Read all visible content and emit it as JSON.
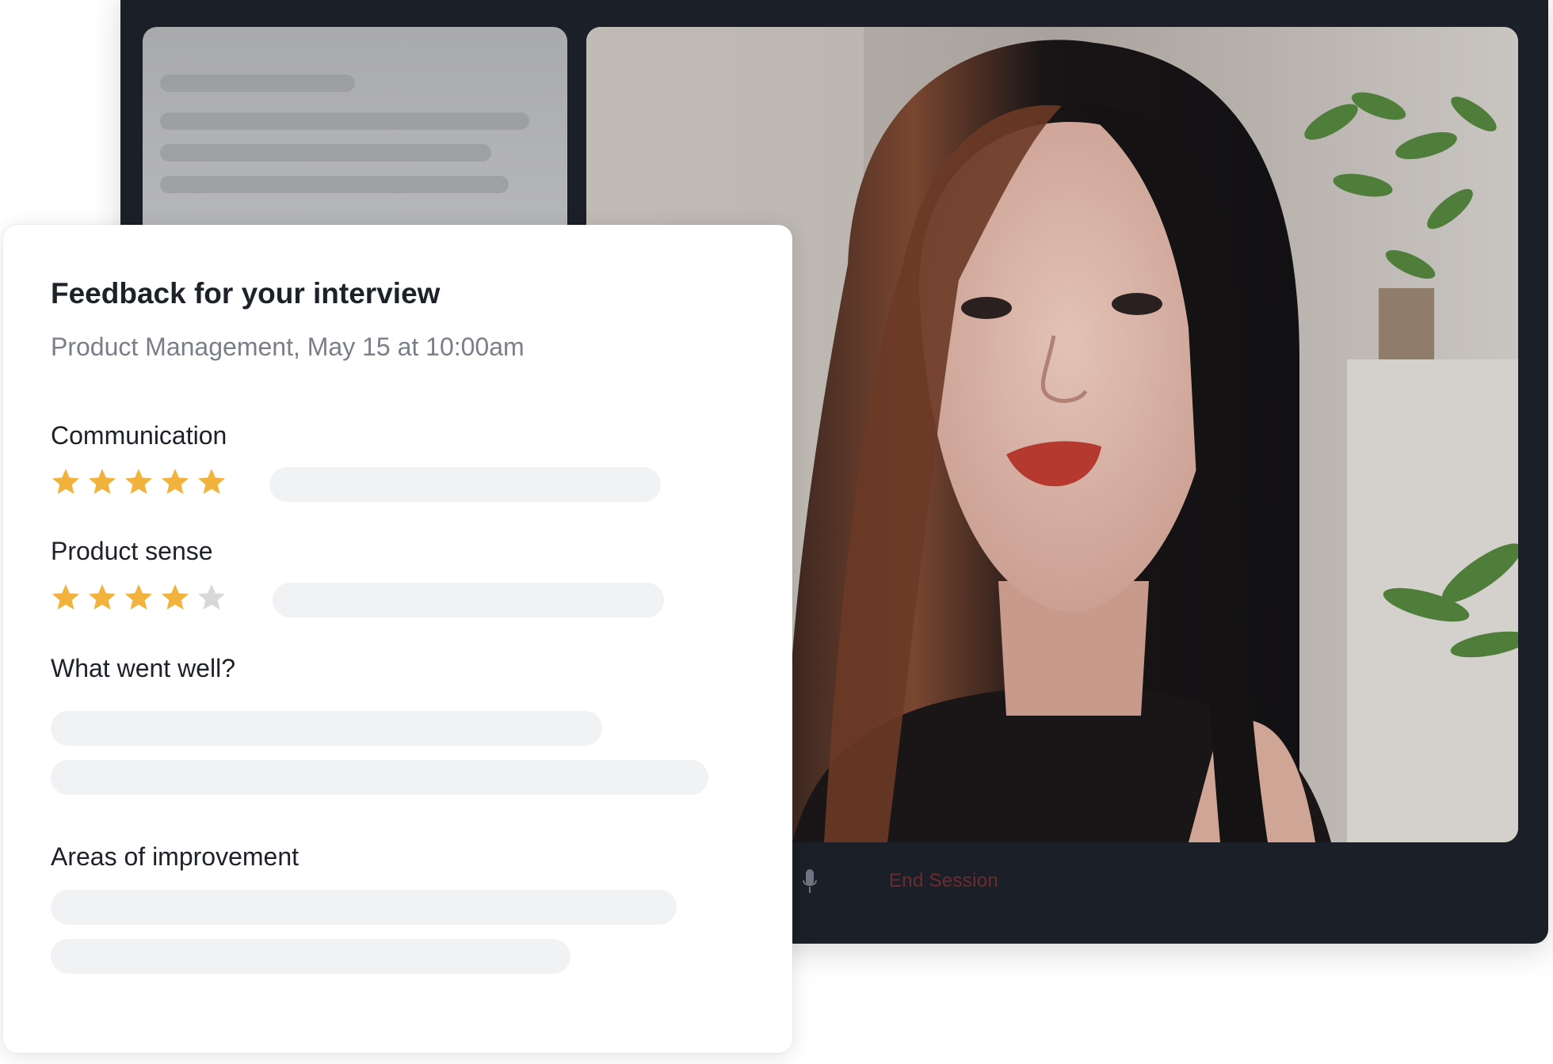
{
  "feedback": {
    "title": "Feedback for your interview",
    "subtitle": "Product Management, May 15 at 10:00am",
    "sections": [
      {
        "label": "Communication",
        "rating": 5,
        "max_rating": 5
      },
      {
        "label": "Product sense",
        "rating": 4,
        "max_rating": 5
      },
      {
        "label": "What went well?"
      },
      {
        "label": "Areas of improvement"
      }
    ]
  },
  "call": {
    "end_session_label": "End Session"
  },
  "colors": {
    "star_filled": "#f2b33d",
    "star_empty": "#d7d8da",
    "call_background": "#1b1f27",
    "end_session_text": "#6a2c2f"
  },
  "icons": {
    "star": "star-icon",
    "microphone": "microphone-icon"
  }
}
